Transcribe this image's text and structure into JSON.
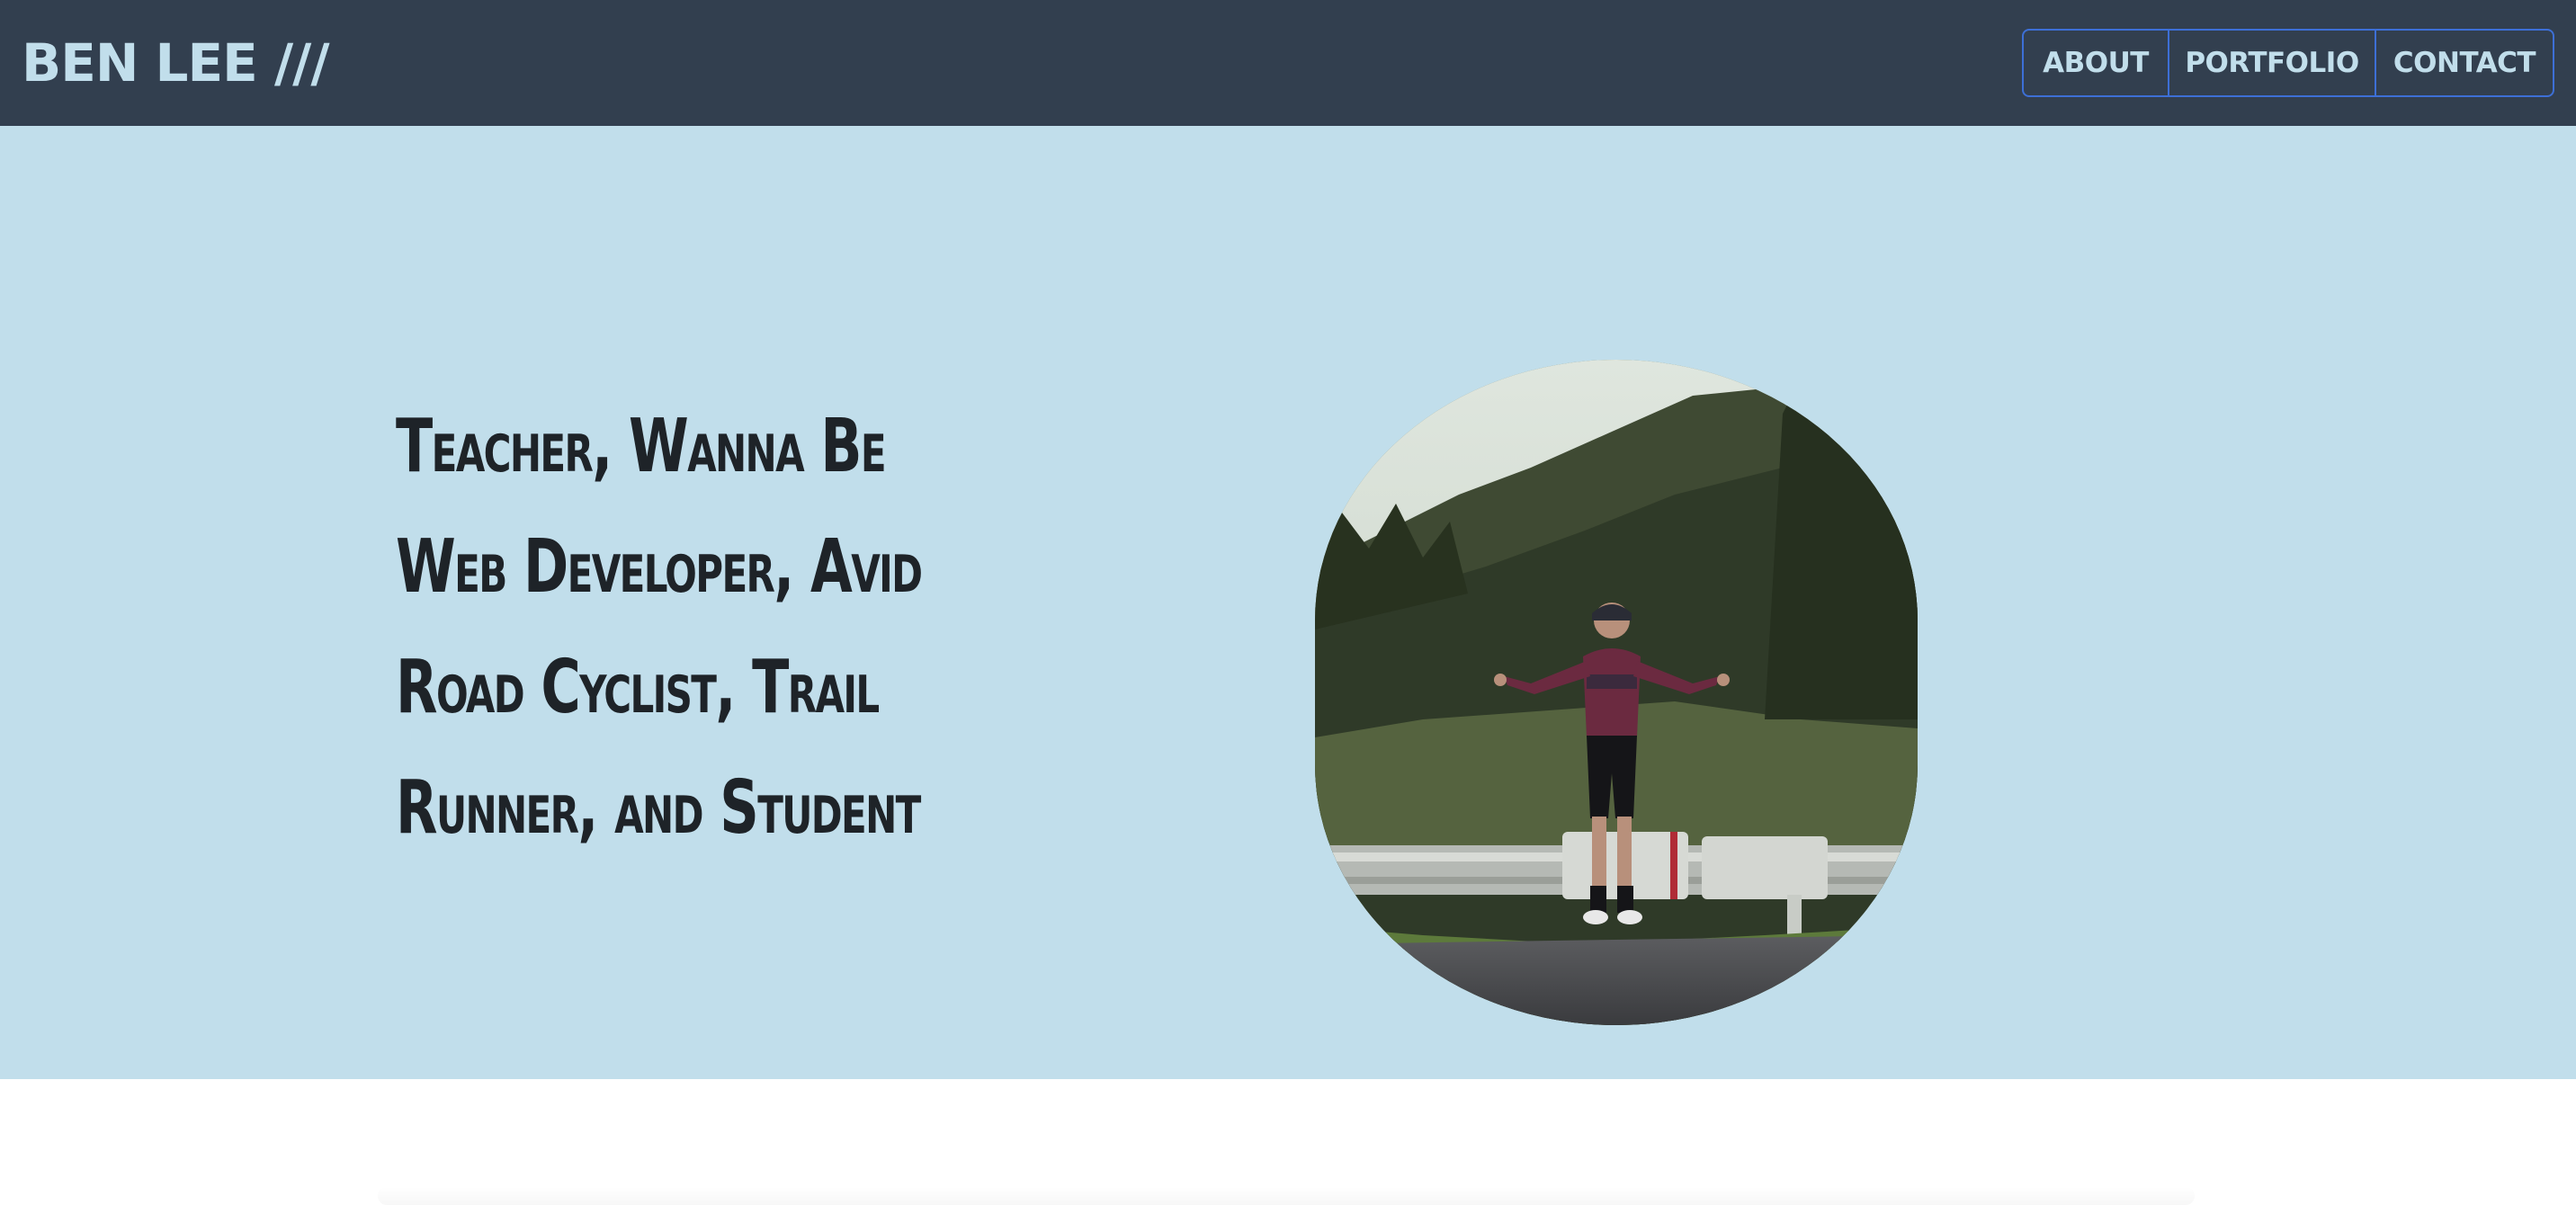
{
  "header": {
    "brand": "BEN LEE ///",
    "nav": [
      {
        "label": "ABOUT"
      },
      {
        "label": "PORTFOLIO"
      },
      {
        "label": "CONTACT"
      }
    ]
  },
  "hero": {
    "tagline": "Teacher, Wanna Be Web Developer, Avid Road Cyclist, Trail Runner, and Student"
  },
  "colors": {
    "navbar_bg": "#323f4f",
    "brand_text": "#c1deeb",
    "nav_border": "#3d6fd6",
    "hero_bg": "#c1deeb",
    "tagline_text": "#1e2328"
  }
}
